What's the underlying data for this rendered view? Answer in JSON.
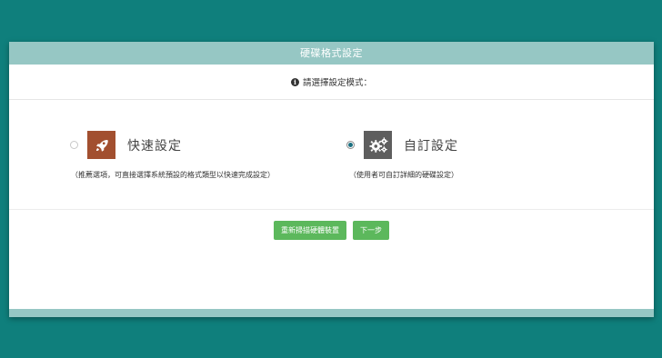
{
  "dialog": {
    "title": "硬碟格式設定",
    "subtitle": "請選擇設定模式：",
    "info_icon": "info-circle-icon"
  },
  "options": [
    {
      "label": "快速設定",
      "description": "（推薦選項，可直接選擇系統預設的格式類型以快速完成設定）",
      "icon": "rocket-icon",
      "icon_color": "#a24f2f",
      "selected": false
    },
    {
      "label": "自訂設定",
      "description": "（使用者可自訂詳細的硬碟設定）",
      "icon": "gears-icon",
      "icon_color": "#5e5e5e",
      "selected": true
    }
  ],
  "buttons": {
    "rescan": "重新掃描硬體裝置",
    "next": "下一步"
  },
  "colors": {
    "background": "#0f7f7c",
    "header": "#96c7c4",
    "button": "#5cb85c",
    "radio_selected": "#1b6f80"
  }
}
